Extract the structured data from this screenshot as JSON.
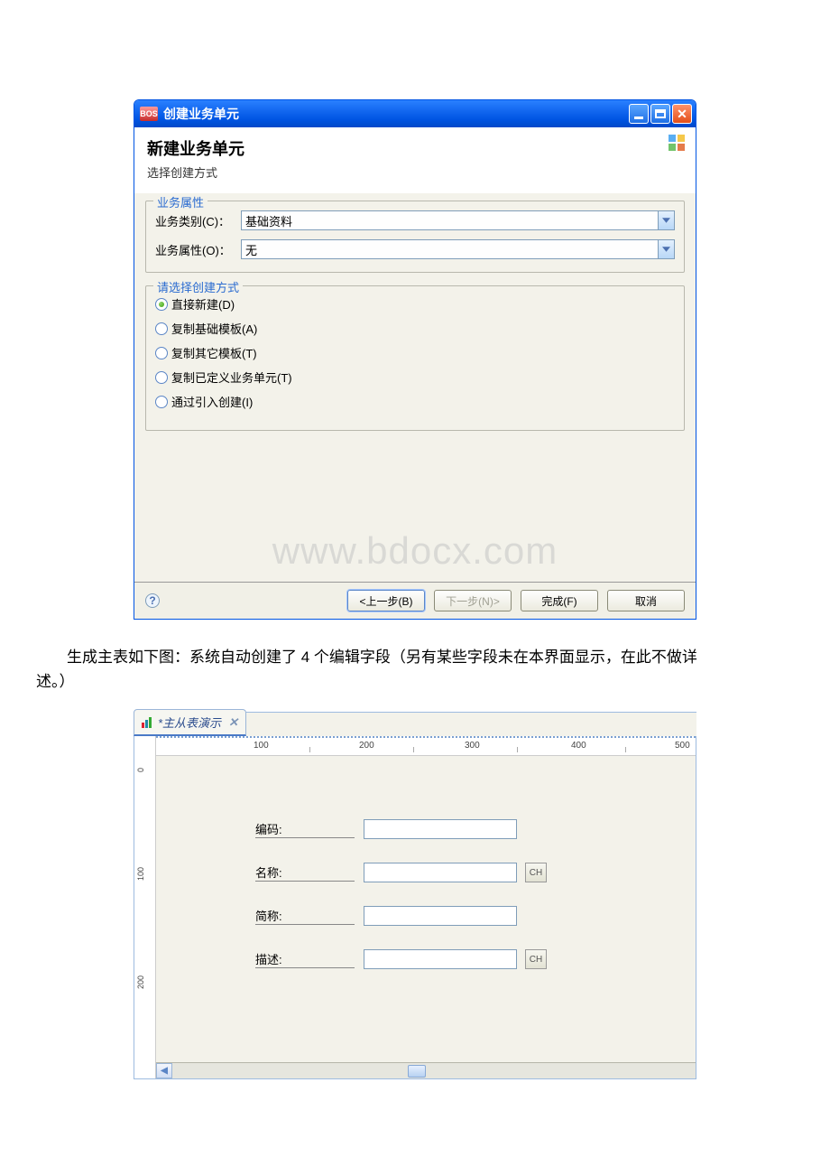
{
  "dialog": {
    "app_icon_text": "BOS",
    "title": "创建业务单元",
    "header_title": "新建业务单元",
    "header_subtitle": "选择创建方式",
    "group_props_title": "业务属性",
    "label_category": "业务类别(C)：",
    "value_category": "基础资料",
    "label_attr": "业务属性(O)：",
    "value_attr": "无",
    "group_create_title": "请选择创建方式",
    "radio1": "直接新建(D)",
    "radio2": "复制基础模板(A)",
    "radio3": "复制其它模板(T)",
    "radio4": "复制已定义业务单元(T)",
    "radio5": "通过引入创建(I)",
    "watermark": "www.bdocx.com",
    "btn_back": "<上一步(B)",
    "btn_next": "下一步(N)>",
    "btn_finish": "完成(F)",
    "btn_cancel": "取消"
  },
  "doc_text": "　　生成主表如下图：系统自动创建了 4 个编辑字段（另有某些字段未在本界面显示，在此不做详述。）",
  "designer": {
    "tab_title": "*主从表演示",
    "ruler_h": [
      "100",
      "200",
      "300",
      "400",
      "500"
    ],
    "ruler_v": [
      "0",
      "100",
      "200"
    ],
    "field1_label": "编码:",
    "field2_label": "名称:",
    "field3_label": "简称:",
    "field4_label": "描述:",
    "ch_text": "CH"
  }
}
